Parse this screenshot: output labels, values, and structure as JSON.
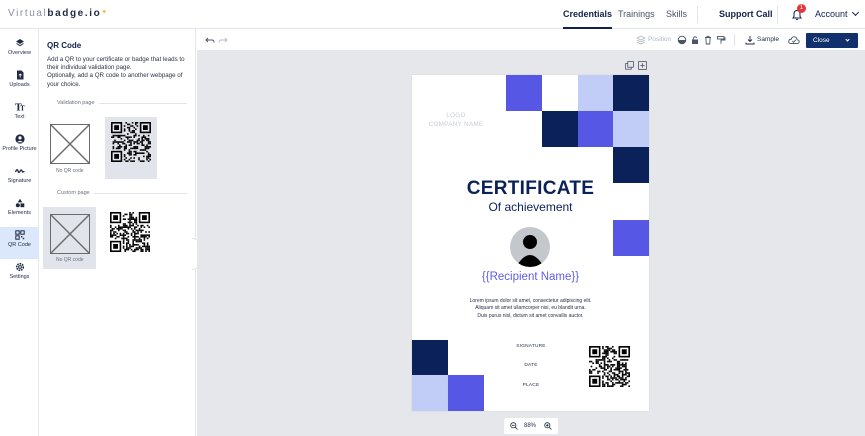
{
  "brand": {
    "name_light": "Virtual",
    "name_bold": "badge.io"
  },
  "topnav": {
    "credentials": "Credentials",
    "trainings": "Trainings",
    "skills": "Skills",
    "support": "Support Call",
    "notifications": "1",
    "account": "Account"
  },
  "rail": {
    "items": [
      {
        "label": "Overview",
        "icon": "layers-icon"
      },
      {
        "label": "Uploads",
        "icon": "file-upload-icon"
      },
      {
        "label": "Text",
        "icon": "text-icon"
      },
      {
        "label": "Profile Picture",
        "icon": "user-circle-icon"
      },
      {
        "label": "Signature",
        "icon": "signature-icon"
      },
      {
        "label": "Elements",
        "icon": "shapes-icon"
      },
      {
        "label": "QR Code",
        "icon": "qr-code-icon"
      },
      {
        "label": "Settings",
        "icon": "gear-icon"
      }
    ]
  },
  "panel": {
    "title": "QR Code",
    "desc1": "Add a QR to your certificate or badge that leads to their individual validation page.",
    "desc2": "Optionally, add a QR code to another webpage of your choice.",
    "validation_label": "Validation page",
    "custom_label": "Custom page",
    "no_qr": "No QR code"
  },
  "toolbar": {
    "position": "Position",
    "sample": "Sample",
    "close": "Close"
  },
  "certificate": {
    "logo_line1": "LOGO",
    "logo_line2": "COMPANY NAME",
    "title": "CERTIFICATE",
    "subtitle": "Of achievement",
    "recipient": "{{Recipient Name}}",
    "body1": "Lorem ipsum dolor sit amet, consectetur adipiscing elit.",
    "body2": "Aliquam sit amet ullamcorper nisi, eu blandit urna.",
    "body3": "Duis purus nisl, dictum sit amet convallis auctor.",
    "signature": "SIGNATURE",
    "date": "DATE",
    "place": "PLACE"
  },
  "zoom": {
    "level": "88%"
  },
  "colors": {
    "navy": "#0b2159",
    "indigo": "#5757e6",
    "light": "#c2cdf7",
    "active_tab": "#dbe7fa"
  }
}
